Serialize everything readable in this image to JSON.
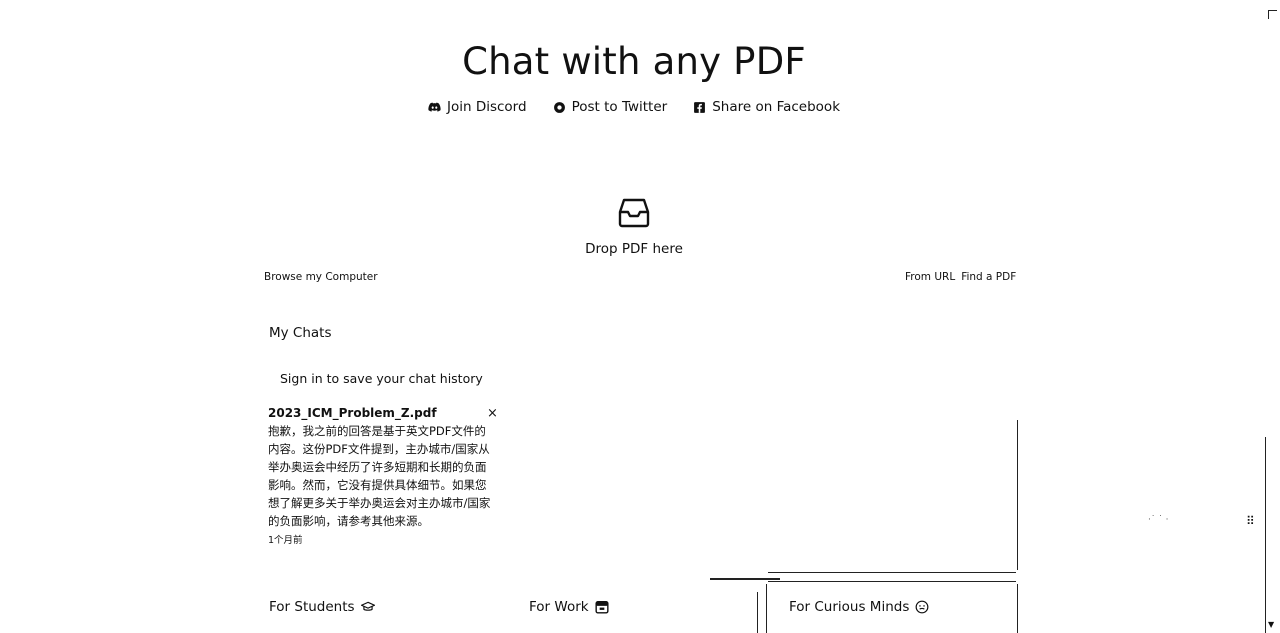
{
  "header": {
    "title": "Chat with any PDF",
    "links": [
      {
        "label": "Join Discord",
        "icon": "discord-icon"
      },
      {
        "label": "Post to Twitter",
        "icon": "twitter-icon"
      },
      {
        "label": "Share on Facebook",
        "icon": "facebook-icon"
      }
    ]
  },
  "upload": {
    "icon": "inbox-icon",
    "drop_label": "Drop PDF here",
    "browse_label": "Browse my Computer",
    "from_url_label": "From URL",
    "find_pdf_label": "Find a PDF"
  },
  "chats": {
    "heading": "My Chats",
    "signin_text": "Sign in to save your chat history",
    "items": [
      {
        "title": "2023_ICM_Problem_Z.pdf",
        "close_glyph": "×",
        "preview": "抱歉，我之前的回答是基于英文PDF文件的内容。这份PDF文件提到，主办城市/国家从举办奥运会中经历了许多短期和长期的负面影响。然而，它没有提供具体细节。如果您想了解更多关于举办奥运会对主办城市/国家的负面影响，请参考其他来源。",
        "time": "1个月前"
      }
    ]
  },
  "categories": [
    {
      "label": "For Students",
      "icon": "graduation-cap-icon"
    },
    {
      "label": "For Work",
      "icon": "briefcase-icon"
    },
    {
      "label": "For Curious Minds",
      "icon": "smiley-icon"
    }
  ],
  "misc": {
    "drag_handle_glyph": "⠿",
    "scroll_arrow_glyph": "▼"
  }
}
